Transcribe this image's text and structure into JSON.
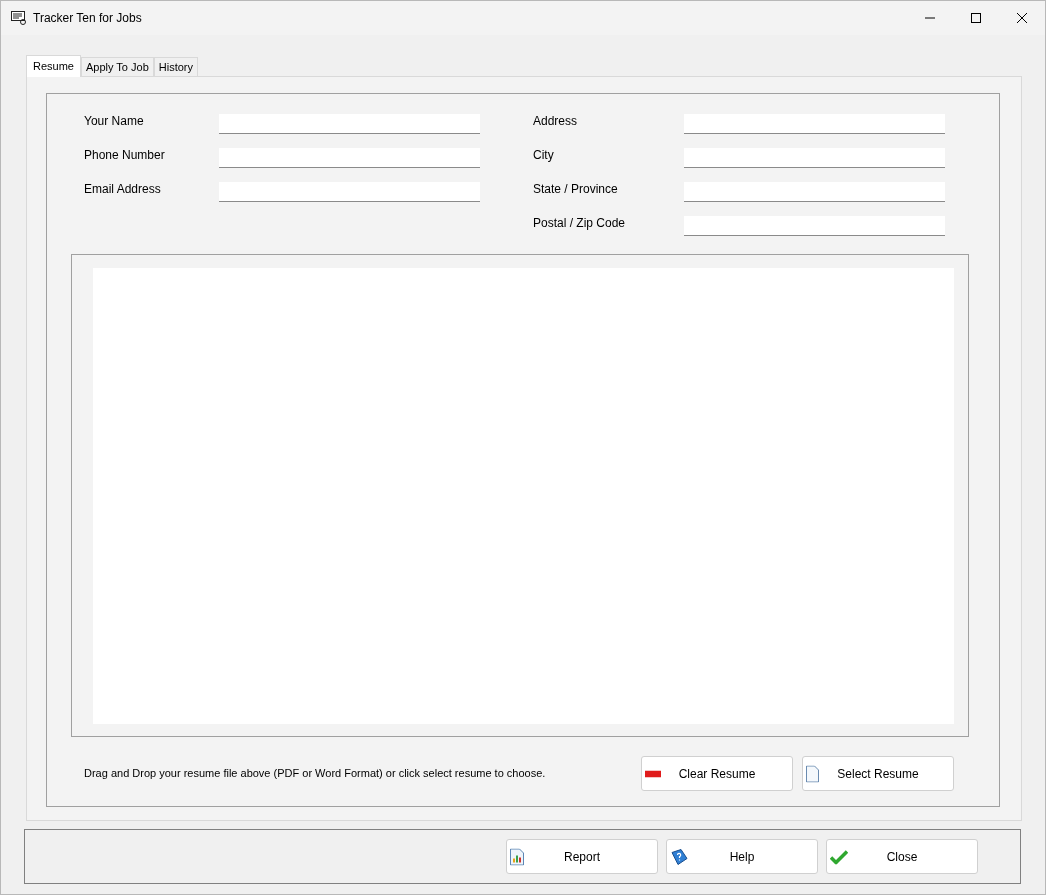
{
  "window": {
    "title": "Tracker Ten for Jobs"
  },
  "tabs": [
    {
      "label": "Resume",
      "selected": true
    },
    {
      "label": "Apply To Job",
      "selected": false
    },
    {
      "label": "History",
      "selected": false
    }
  ],
  "left_fields": [
    {
      "label": "Your Name"
    },
    {
      "label": "Phone Number"
    },
    {
      "label": "Email Address"
    }
  ],
  "right_fields": [
    {
      "label": "Address"
    },
    {
      "label": "City"
    },
    {
      "label": "State / Province"
    },
    {
      "label": "Postal / Zip Code"
    }
  ],
  "instructions": "Drag and Drop your resume file above (PDF or Word Format) or click select resume to choose.",
  "resume_buttons": [
    {
      "label": "Clear Resume",
      "kind": "clear"
    },
    {
      "label": "Select Resume",
      "kind": "select"
    }
  ],
  "footer_buttons": [
    {
      "label": "Report",
      "kind": "report"
    },
    {
      "label": "Help",
      "kind": "help"
    },
    {
      "label": "Close",
      "kind": "close"
    }
  ]
}
